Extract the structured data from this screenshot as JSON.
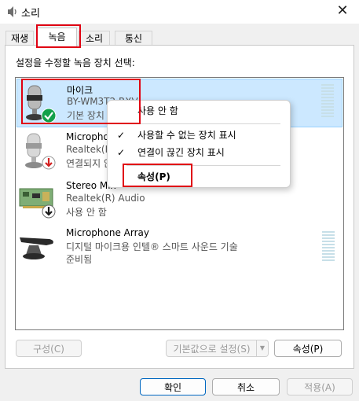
{
  "window": {
    "title": "소리"
  },
  "tabs": [
    {
      "label": "재생"
    },
    {
      "label": "녹음"
    },
    {
      "label": "소리"
    },
    {
      "label": "통신"
    }
  ],
  "instruction": "설정을 수정할 녹음 장치 선택:",
  "devices": [
    {
      "name": "마이크",
      "line2": "BY-WM3T2 RXV",
      "line3": "기본 장치",
      "status": "default",
      "icon": "microphone-icon"
    },
    {
      "name": "Microphone",
      "line2": "Realtek(R) Audio",
      "line3": "연결되지 않음",
      "status": "disconnected",
      "icon": "microphone-icon"
    },
    {
      "name": "Stereo Mix",
      "line2": "Realtek(R) Audio",
      "line3": "사용 안 함",
      "status": "disabled",
      "icon": "sound-card-icon"
    },
    {
      "name": "Microphone Array",
      "line2": "디지털 마이크용 인텔® 스마트 사운드 기술",
      "line3": "준비됨",
      "status": "ready",
      "icon": "microphone-array-icon"
    }
  ],
  "context_menu": {
    "disable": "사용 안 함",
    "show_disabled": "사용할 수 없는 장치 표시",
    "show_disconnected": "연결이 끊긴 장치 표시",
    "properties": "속성(P)"
  },
  "buttons": {
    "configure": "구성(C)",
    "set_default": "기본값으로 설정(S)",
    "properties": "속성(P)",
    "ok": "확인",
    "cancel": "취소",
    "apply": "적용(A)"
  },
  "colors": {
    "selection_bg": "#cce8ff",
    "highlight_box": "#e00012",
    "default_badge": "#12a04a",
    "disconnected_badge": "#d32020"
  }
}
